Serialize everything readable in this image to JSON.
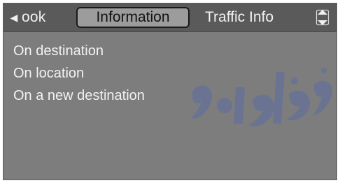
{
  "tabs": {
    "left_label": "ook",
    "active_label": "Information",
    "right_label": "Traffic Info"
  },
  "menu": {
    "items": [
      {
        "label": "On destination"
      },
      {
        "label": "On location"
      },
      {
        "label": "On a new destination"
      }
    ]
  },
  "icons": {
    "left_tab_arrow": "left-arrow-icon",
    "scroll_control": "up-down-scroll-icon"
  },
  "colors": {
    "panel_background": "#7d7d7d",
    "tab_bar": "#5a5a5a",
    "active_tab": "#9c9c9c",
    "text": "#f2f2f2",
    "watermark": "#5f6f9f"
  },
  "watermark_lettering": "رو فارما"
}
